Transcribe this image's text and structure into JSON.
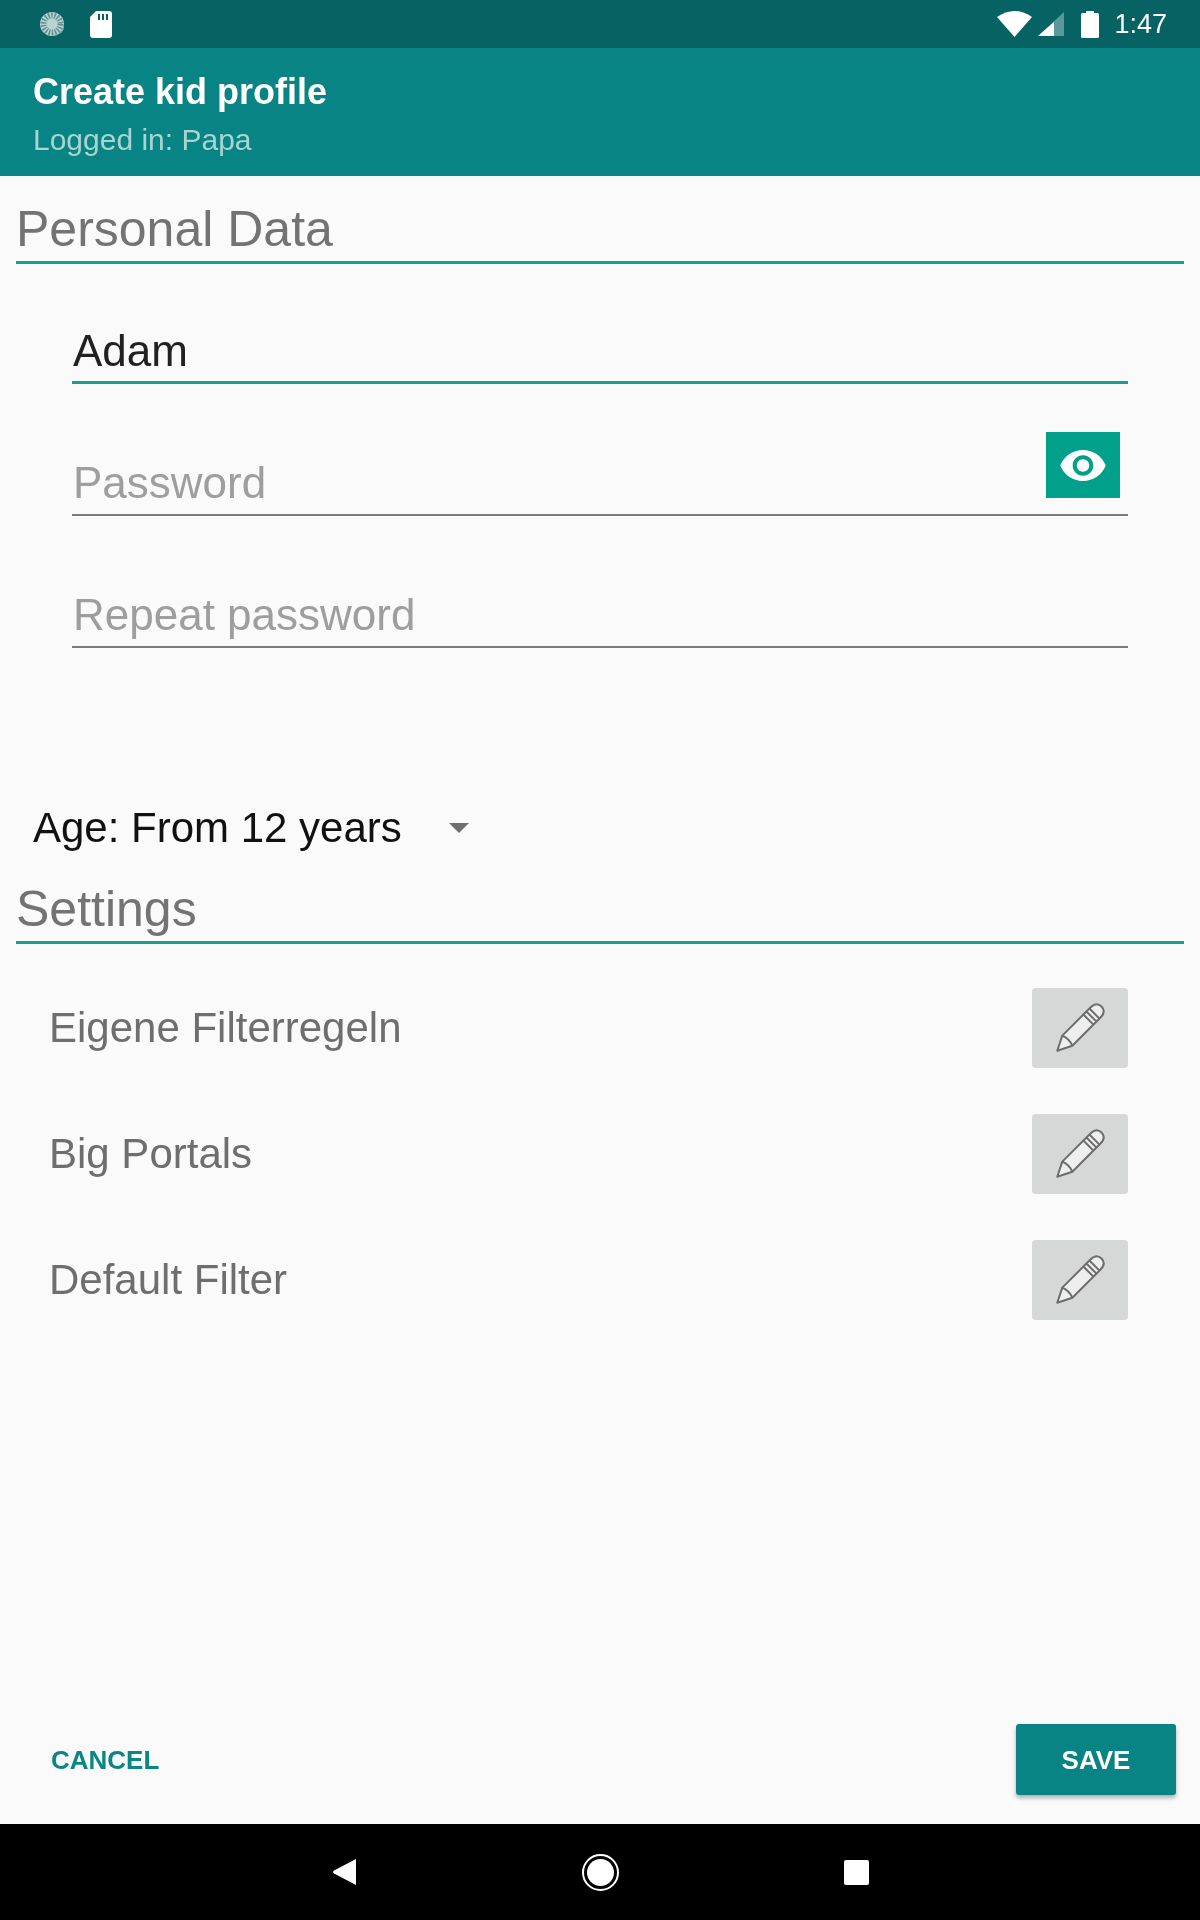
{
  "status_bar": {
    "time": "1:47"
  },
  "toolbar": {
    "title": "Create kid profile",
    "subtitle": "Logged in: Papa"
  },
  "personal_data": {
    "heading": "Personal Data",
    "fields": [
      {
        "value": "Adam",
        "focused": true,
        "visibility_toggle": false
      },
      {
        "placeholder": "Password",
        "focused": false,
        "visibility_toggle": true
      },
      {
        "placeholder": "Repeat password",
        "focused": false,
        "visibility_toggle": false
      }
    ]
  },
  "age_spinner": {
    "value": "Age: From 12 years"
  },
  "settings": {
    "heading": "Settings",
    "items": [
      {
        "label": "Eigene Filterregeln"
      },
      {
        "label": "Big Portals"
      },
      {
        "label": "Default Filter"
      }
    ]
  },
  "actions": [
    {
      "kind": "dismiss",
      "label": "CANCEL"
    },
    {
      "kind": "confirm",
      "label": "SAVE"
    }
  ]
}
